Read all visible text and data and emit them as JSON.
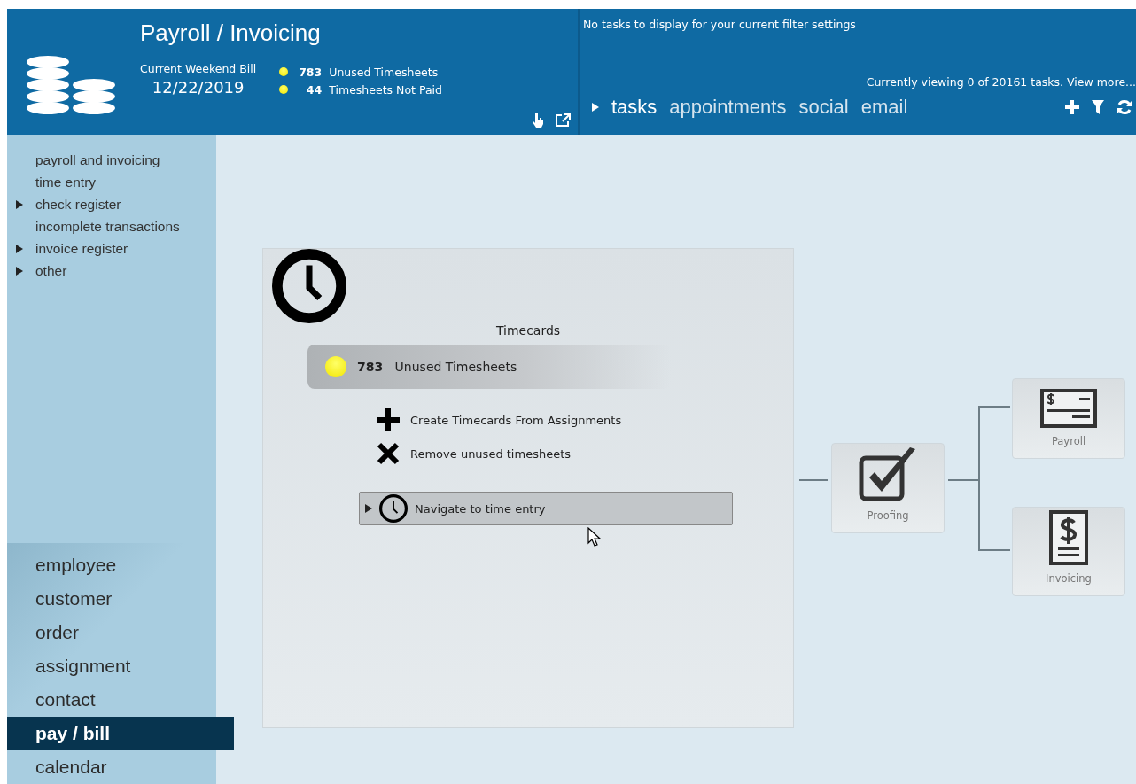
{
  "header": {
    "title": "Payroll / Invoicing",
    "bill_label": "Current Weekend Bill",
    "bill_date": "12/22/2019",
    "stats": [
      {
        "count": "783",
        "label": "Unused Timesheets"
      },
      {
        "count": "44",
        "label": "Timesheets Not Paid"
      }
    ]
  },
  "tasks_panel": {
    "message": "No tasks to display for your current filter settings",
    "viewing": "Currently viewing 0 of 20161 tasks. View more...",
    "tabs": [
      {
        "label": "tasks",
        "selected": true
      },
      {
        "label": "appointments",
        "selected": false
      },
      {
        "label": "social",
        "selected": false
      },
      {
        "label": "email",
        "selected": false
      }
    ]
  },
  "sidebar": {
    "menu": [
      {
        "label": "payroll and invoicing",
        "expandable": false
      },
      {
        "label": "time entry",
        "expandable": false
      },
      {
        "label": "check register",
        "expandable": true
      },
      {
        "label": "incomplete transactions",
        "expandable": false
      },
      {
        "label": "invoice register",
        "expandable": true
      },
      {
        "label": "other",
        "expandable": true
      }
    ],
    "nav": [
      {
        "label": "employee",
        "selected": false
      },
      {
        "label": "customer",
        "selected": false
      },
      {
        "label": "order",
        "selected": false
      },
      {
        "label": "assignment",
        "selected": false
      },
      {
        "label": "contact",
        "selected": false
      },
      {
        "label": "pay / bill",
        "selected": true
      },
      {
        "label": "calendar",
        "selected": false
      }
    ]
  },
  "card": {
    "title": "Timecards",
    "status": {
      "count": "783",
      "label": "Unused Timesheets"
    },
    "actions": [
      {
        "kind": "create",
        "label": "Create Timecards From Assignments"
      },
      {
        "kind": "remove",
        "label": "Remove unused timesheets"
      }
    ],
    "navigate": {
      "label": "Navigate to time entry"
    }
  },
  "workflow": {
    "nodes": [
      {
        "kind": "proofing",
        "label": "Proofing"
      },
      {
        "kind": "payroll",
        "label": "Payroll"
      },
      {
        "kind": "invoicing",
        "label": "Invoicing"
      }
    ]
  }
}
